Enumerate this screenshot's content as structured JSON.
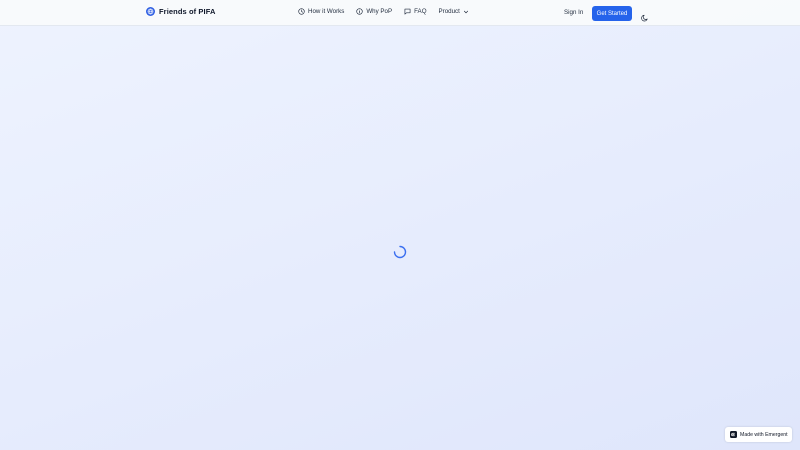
{
  "header": {
    "brand_name": "Friends of PIFA",
    "brand_icon": "globe-icon",
    "nav": [
      {
        "label": "How it Works",
        "icon": "clock-icon"
      },
      {
        "label": "Why PoP",
        "icon": "info-icon"
      },
      {
        "label": "FAQ",
        "icon": "message-icon"
      },
      {
        "label": "Product",
        "icon": "chevron-down-icon"
      }
    ],
    "sign_in_label": "Sign In",
    "get_started_label": "Get Started",
    "theme_toggle_icon": "moon-icon"
  },
  "main": {
    "loading_indicator": "spinner-icon"
  },
  "badge": {
    "label": "Made with Emergent",
    "icon": "emergent-logo-icon"
  },
  "colors": {
    "accent": "#2563eb",
    "background": "#e9eefd",
    "text": "#0f172a"
  }
}
